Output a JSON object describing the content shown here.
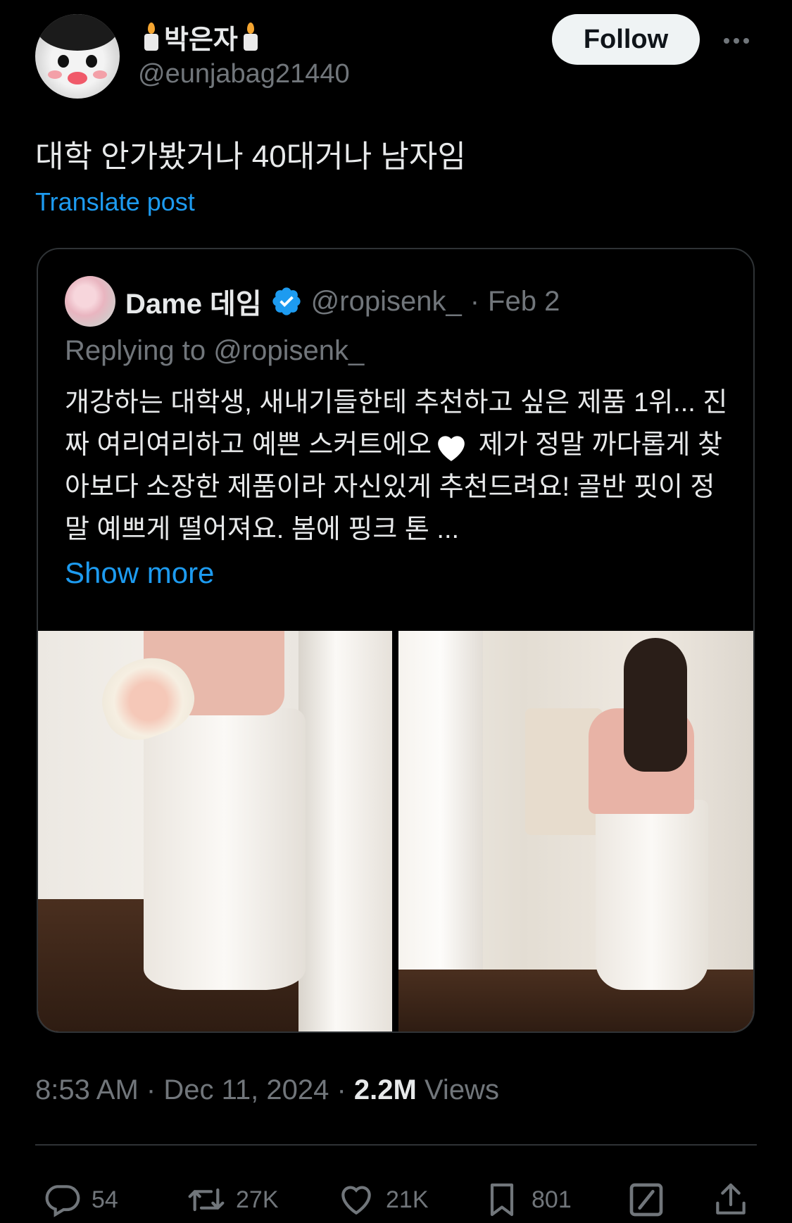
{
  "author": {
    "display_name": "박은자",
    "handle": "@eunjabag21440"
  },
  "follow_label": "Follow",
  "post_text": "대학 안가봤거나 40대거나 남자임",
  "translate_label": "Translate post",
  "quote": {
    "display_name": "Dame 데임",
    "handle": "@ropisenk_",
    "separator": "·",
    "date": "Feb 2",
    "replying_to": "Replying to @ropisenk_",
    "body_before_heart": "개강하는 대학생, 새내기들한테 추천하고 싶은 제품 1위... 진짜 여리여리하고 예쁜 스커트에오",
    "body_after_heart": " 제가 정말 까다롭게 찾아보다 소장한 제품이라 자신있게 추천드려요! 골반 핏이 정말 예쁘게 떨어져요. 봄에 핑크 톤 ...",
    "show_more": "Show more"
  },
  "meta": {
    "time": "8:53 AM",
    "sep1": "·",
    "date": "Dec 11, 2024",
    "sep2": "·",
    "views_count": "2.2M",
    "views_label": "Views"
  },
  "actions": {
    "replies": "54",
    "reposts": "27K",
    "likes": "21K",
    "bookmarks": "801"
  },
  "colors": {
    "background": "#000000",
    "text": "#e7e9ea",
    "muted": "#71767b",
    "link": "#1d9bf0",
    "border": "#2f3336",
    "follow_bg": "#eff3f4"
  }
}
